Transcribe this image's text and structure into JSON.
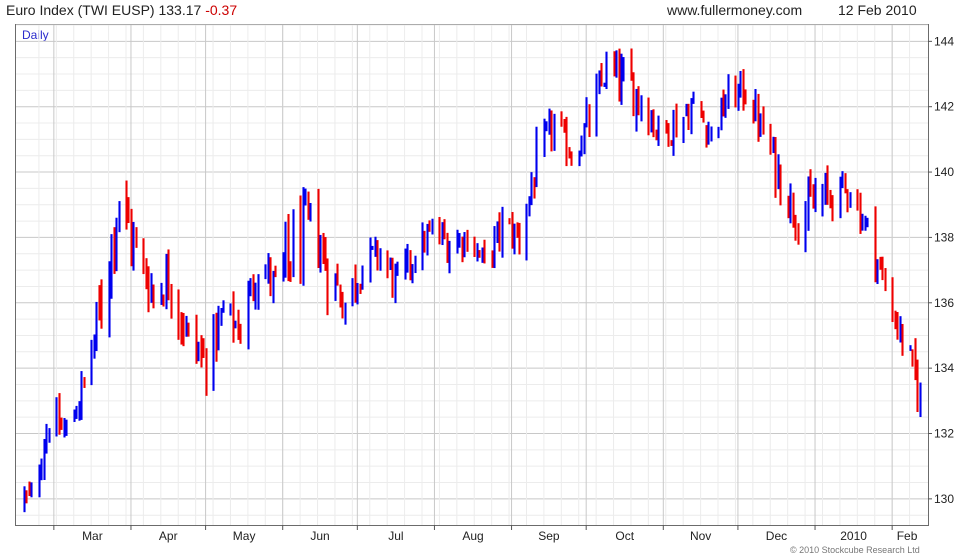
{
  "header": {
    "title": "Euro Index (TWI EUSP) 133.17",
    "change": "-0.37",
    "website": "www.fullermoney.com",
    "date": "12 Feb 2010"
  },
  "period_label": "Daily",
  "copyright": "© 2010 Stockcube Research Ltd",
  "colors": {
    "up": "#0000ee",
    "down": "#ee0000",
    "grid": "#d8d8d8",
    "frame": "#6b6b6b"
  },
  "chart_data": {
    "type": "candlestick",
    "title": "Euro Index (TWI EUSP)",
    "last_value": 133.17,
    "change": -0.37,
    "frequency": "Daily",
    "ylim": [
      129.2,
      144.5
    ],
    "y_ticks": [
      "130",
      "132",
      "134",
      "136",
      "138",
      "140",
      "142",
      "144"
    ],
    "x_tick_labels": [
      "Mar",
      "Apr",
      "May",
      "Jun",
      "Jul",
      "Aug",
      "Sep",
      "Oct",
      "Nov",
      "Dec",
      "2010",
      "Feb"
    ],
    "y_axis_side": "right",
    "grid": true,
    "trend": {
      "x": [
        "2009-02-20",
        "2009-02-27",
        "2009-03-06",
        "2009-03-13",
        "2009-03-20",
        "2009-03-27",
        "2009-04-03",
        "2009-04-10",
        "2009-04-17",
        "2009-04-24",
        "2009-05-01",
        "2009-05-08",
        "2009-05-15",
        "2009-05-22",
        "2009-05-29",
        "2009-06-05",
        "2009-06-12",
        "2009-06-19",
        "2009-06-26",
        "2009-07-03",
        "2009-07-10",
        "2009-07-17",
        "2009-07-24",
        "2009-07-31",
        "2009-08-07",
        "2009-08-14",
        "2009-08-21",
        "2009-08-28",
        "2009-09-04",
        "2009-09-11",
        "2009-09-18",
        "2009-09-25",
        "2009-10-02",
        "2009-10-09",
        "2009-10-16",
        "2009-10-23",
        "2009-10-30",
        "2009-11-06",
        "2009-11-13",
        "2009-11-20",
        "2009-11-27",
        "2009-12-04",
        "2009-12-11",
        "2009-12-18",
        "2009-12-25",
        "2010-01-01",
        "2010-01-08",
        "2010-01-15",
        "2010-01-22",
        "2010-01-29",
        "2010-02-05",
        "2010-02-12"
      ],
      "close": [
        130.0,
        132.4,
        132.0,
        133.5,
        136.0,
        139.3,
        137.5,
        136.3,
        136.8,
        134.8,
        134.2,
        135.7,
        135.2,
        137.2,
        136.5,
        137.5,
        138.5,
        137.0,
        136.0,
        137.2,
        137.5,
        136.5,
        137.5,
        138.2,
        137.8,
        138.0,
        137.2,
        138.3,
        138.0,
        140.2,
        141.5,
        140.5,
        141.5,
        143.2,
        142.7,
        142.3,
        141.2,
        141.5,
        142.0,
        141.2,
        142.3,
        142.5,
        141.2,
        139.8,
        138.5,
        139.0,
        139.3,
        139.5,
        138.2,
        136.5,
        134.8,
        133.2
      ],
      "low": [
        129.9,
        131.3,
        131.2,
        132.5,
        134.6,
        136.5,
        136.1,
        135.3,
        134.5,
        133.3,
        133.4,
        134.6,
        134.8,
        135.8,
        135.0,
        136.0,
        137.2,
        135.5,
        135.3,
        136.0,
        136.3,
        135.6,
        136.6,
        137.3,
        136.5,
        137.1,
        136.6,
        137.3,
        137.2,
        138.6,
        140.2,
        140.2,
        140.3,
        142.2,
        141.4,
        140.6,
        140.4,
        140.6,
        141.0,
        140.5,
        141.2,
        141.1,
        140.1,
        138.1,
        137.9,
        138.3,
        138.4,
        138.6,
        137.1,
        135.6,
        133.8,
        132.6
      ],
      "high": [
        131.5,
        133.1,
        133.2,
        134.5,
        137.8,
        139.9,
        138.8,
        137.5,
        137.2,
        136.1,
        135.5,
        136.6,
        136.5,
        138.1,
        137.0,
        140.6,
        139.3,
        138.3,
        137.5,
        137.9,
        138.0,
        137.6,
        138.1,
        138.6,
        138.5,
        138.3,
        138.1,
        139.1,
        138.9,
        140.9,
        141.8,
        141.5,
        142.5,
        143.6,
        143.7,
        143.0,
        141.8,
        142.5,
        142.7,
        142.0,
        142.9,
        142.9,
        141.6,
        140.5,
        139.5,
        141.5,
        140.0,
        140.1,
        139.0,
        137.0,
        135.6,
        134.7
      ]
    }
  }
}
